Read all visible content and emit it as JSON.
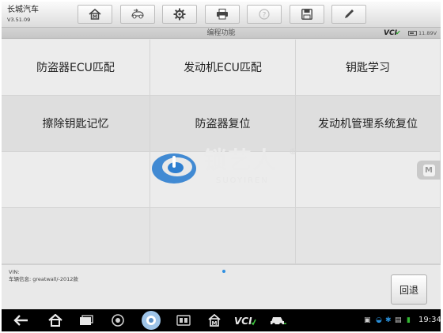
{
  "app": {
    "title": "长城汽车",
    "version": "V3.51.09"
  },
  "toolbar": {
    "buttons": [
      {
        "name": "home",
        "icon": "home-icon"
      },
      {
        "name": "vehicle-swap",
        "icon": "vehicle-swap-icon"
      },
      {
        "name": "settings",
        "icon": "gear-icon"
      },
      {
        "name": "print",
        "icon": "printer-icon"
      },
      {
        "name": "help",
        "icon": "help-icon"
      },
      {
        "name": "save",
        "icon": "save-icon"
      },
      {
        "name": "edit",
        "icon": "pencil-icon"
      }
    ]
  },
  "subheader": {
    "title": "编程功能",
    "vci_label": "VCI",
    "voltage": "11.89V",
    "vci_status_color": "#2aa12a"
  },
  "functions": [
    {
      "label": "防盗器ECU匹配"
    },
    {
      "label": "发动机ECU匹配"
    },
    {
      "label": "钥匙学习"
    },
    {
      "label": "擦除钥匙记忆"
    },
    {
      "label": "防盗器复位"
    },
    {
      "label": "发动机管理系统复位"
    }
  ],
  "watermark": {
    "text": "锁艺人",
    "sub": "SUOYIREN",
    "reg": "®"
  },
  "side_button": {
    "label": "M"
  },
  "footer": {
    "vin_label": "VIN:",
    "vehicle_info": "车辆信息: greatwall/-2012款",
    "back_label": "回退"
  },
  "navbar": {
    "icons": [
      "back-icon",
      "home-icon",
      "recent-apps-icon",
      "browser-icon",
      "camera-icon",
      "gallery-icon",
      "maxisys-icon",
      "vci-icon",
      "car-icon"
    ],
    "time": "19:34"
  },
  "colors": {
    "accent": "#2f8fe0",
    "nav_bg": "#000000",
    "wifi": "#2a8fd8",
    "battery": "#33b833"
  }
}
